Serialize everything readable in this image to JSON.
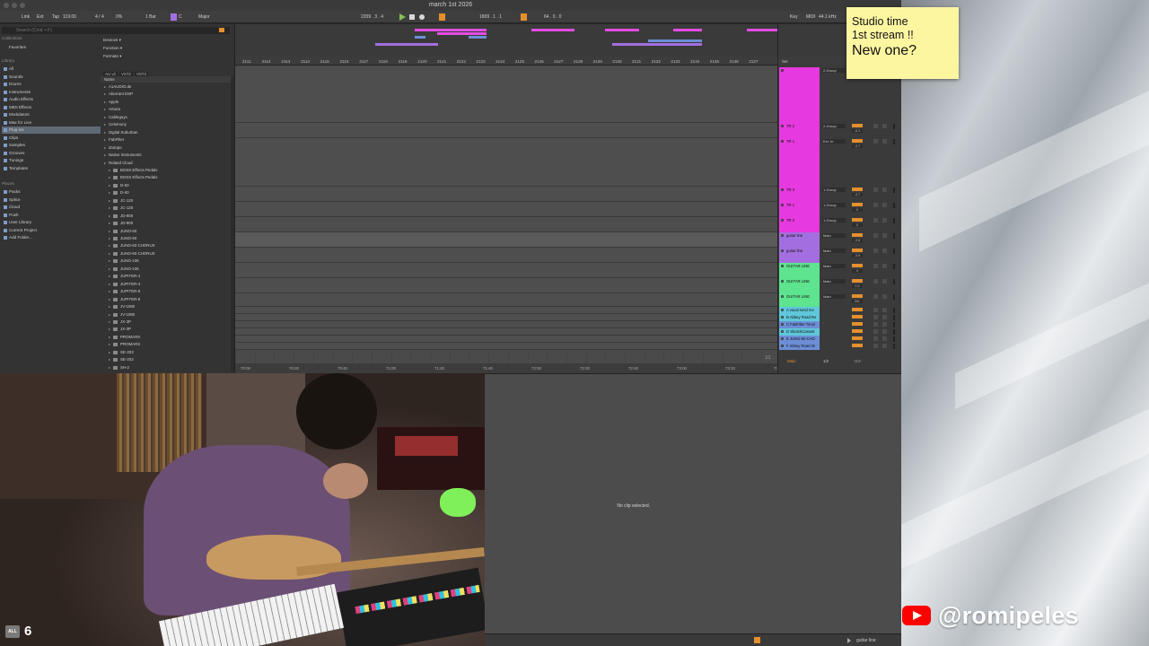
{
  "window": {
    "title": "march 1st 2026"
  },
  "control_bar": {
    "link": "Link",
    "ext": "Ext",
    "tap": "Tap",
    "tempo": "119.00",
    "signature": "4 / 4",
    "cpu_pct": "0%",
    "quantize": "1 Bar",
    "key": "C",
    "scale": "Major",
    "arrangement_position": "2209 .  3 .  4",
    "loop_start": "1809 .  1 .  1",
    "loop_length": "64 .  0 .  0",
    "key_map": "Key",
    "midi_map": "MIDI",
    "sample_rate": "44.1 kHz"
  },
  "browser": {
    "search_placeholder": "Search (Cmd + F)",
    "collections_header": "Collections",
    "favorites": "Favorites",
    "library_header": "Library",
    "library_items": [
      "All",
      "Sounds",
      "Drums",
      "Instruments",
      "Audio Effects",
      "MIDI Effects",
      "Modulators",
      "Max for Live",
      "Plug-ins",
      "Clips",
      "Samples",
      "Grooves",
      "Tunings",
      "Templates"
    ],
    "selected_library_item": "Plug-ins",
    "places_header": "Places",
    "places_items": [
      "Packs",
      "Splice",
      "Cloud",
      "Push",
      "User Library",
      "Current Project",
      "Add Folder..."
    ],
    "filters": [
      "Devices ▾",
      "Function ▾",
      "Formats ▾"
    ],
    "format_tags": [
      "AU v2",
      "VST2",
      "VST3"
    ],
    "creator_filter": "Creator ▾",
    "name_column": "Name",
    "vendors": [
      "A1AUDIO.de",
      "Aberrant DSP",
      "Apple",
      "Arturia",
      "Cableguys",
      "Celemony",
      "Digital Suburban",
      "FabFilter",
      "iZotope",
      "Native Instruments",
      "Roland Cloud"
    ],
    "plugins": [
      "BOSS Effects Pedals",
      "BOSS Effects Pedals",
      "D-50",
      "D-50",
      "JC-120",
      "JC-120",
      "JD-800",
      "JD-800",
      "JUNO-60",
      "JUNO-60",
      "JUNO-60 CHORUS",
      "JUNO-60 CHORUS",
      "JUNO-106",
      "JUNO-106",
      "JUPITER-4",
      "JUPITER-4",
      "JUPITER-8",
      "JUPITER-8",
      "JV-1080",
      "JV-1080",
      "JX-3P",
      "JX-3P",
      "PROMARS",
      "PROMARS",
      "SE-203",
      "SE-203",
      "SH-2"
    ]
  },
  "arrangement": {
    "ruler_labels": [
      "2111",
      "2112",
      "2113",
      "2114",
      "2115",
      "2116",
      "2117",
      "2118",
      "2119",
      "2120",
      "2121",
      "2122",
      "2123",
      "2124",
      "2125",
      "2126",
      "2127",
      "2128",
      "2129",
      "2130",
      "2131",
      "2132",
      "2133",
      "2134",
      "2135",
      "2136",
      "2137"
    ],
    "time_labels": [
      "70:00",
      "70:20",
      "70:40",
      "71:00",
      "71:20",
      "71:40",
      "72:00",
      "72:20",
      "72:40",
      "73:00",
      "73:20",
      "73:40"
    ],
    "clip_name": "guitar line 2",
    "zoom": "1/1"
  },
  "mixer": {
    "set_label": "Set",
    "tracks": [
      {
        "name": "",
        "route": "2-Group",
        "vol": "",
        "color": "#e639df",
        "h": 62
      },
      {
        "name": "TR 2",
        "route": "2-Group",
        "vol": "-6.3",
        "color": "#e639df",
        "h": 17
      },
      {
        "name": "TR 1",
        "route": "Ext. In",
        "vol": "-4.7",
        "color": "#e639df",
        "h": 54
      },
      {
        "name": "TR 3",
        "route": "1-Group",
        "vol": "-4.7",
        "color": "#e639df",
        "h": 17
      },
      {
        "name": "TR 1",
        "route": "1-Group",
        "vol": "0",
        "color": "#e639df",
        "h": 17
      },
      {
        "name": "TR 2",
        "route": "1-Group",
        "vol": "0",
        "color": "#e639df",
        "h": 17
      },
      {
        "name": "guitar line",
        "route": "Main",
        "vol": "-3.8",
        "color": "#a36fe0",
        "h": 17
      },
      {
        "name": "guitar line",
        "route": "Main",
        "vol": "-3.8",
        "color": "#a36fe0",
        "h": 17
      },
      {
        "name": "GUITAR LINE",
        "route": "Main",
        "vol": "0",
        "color": "#5ee38f",
        "h": 17
      },
      {
        "name": "GUITAR LINE",
        "route": "Main",
        "vol": "0.4",
        "color": "#5ee38f",
        "h": 17
      },
      {
        "name": "GUITAR LINE",
        "route": "Main",
        "vol": "50L",
        "color": "#5ee38f",
        "h": 15
      },
      {
        "name": "A vocal send rev",
        "route": "",
        "vol": "0",
        "color": "#5fc7d9",
        "h": 8
      },
      {
        "name": "B Abbey Road Re",
        "route": "",
        "vol": "0",
        "color": "#5fc7d9",
        "h": 8
      },
      {
        "name": "C FabFilter Timel",
        "route": "",
        "vol": "0",
        "color": "#6d8ed6",
        "h": 8
      },
      {
        "name": "D ShotchCassett",
        "route": "",
        "vol": "0",
        "color": "#5fc7d9",
        "h": 8
      },
      {
        "name": "E JUNO-60 CHO",
        "route": "",
        "vol": "0",
        "color": "#6d8ed6",
        "h": 8
      },
      {
        "name": "F Abbey Road St",
        "route": "",
        "vol": "0",
        "color": "#6d8ed6",
        "h": 8
      }
    ],
    "master_name": "Main",
    "master_route": "1/2",
    "master_vol": "-0.0"
  },
  "detail": {
    "empty_message": "No clip selected.",
    "status_track": "guitar line"
  },
  "overlay": {
    "sticky_line1": "Studio time",
    "sticky_line2": "1st stream !!",
    "sticky_line3": "New one?",
    "channel_handle": "@romipeles",
    "viewer_badge": "ALL",
    "viewer_count": "6"
  },
  "colors": {
    "accent_orange": "#e58f2e",
    "pink_track": "#e639df",
    "purple_clip": "#a36fe0",
    "green_track": "#5ee38f",
    "youtube_red": "#ff0000",
    "sticky_yellow": "#fdf6a1"
  }
}
